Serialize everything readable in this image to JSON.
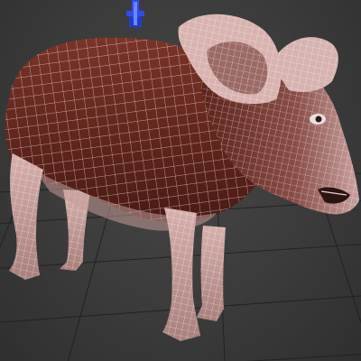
{
  "viewport": {
    "mode": "perspective",
    "background_color": "#3b3b3b",
    "grid_color": "#1f1f1f",
    "gizmo_color": "#2a4cff"
  },
  "model": {
    "subject": "pig",
    "display": "wireframe-on-shaded",
    "body_color": "#6e2d22",
    "skin_color": "#caa0a0",
    "wire_color": "#ffffff"
  }
}
